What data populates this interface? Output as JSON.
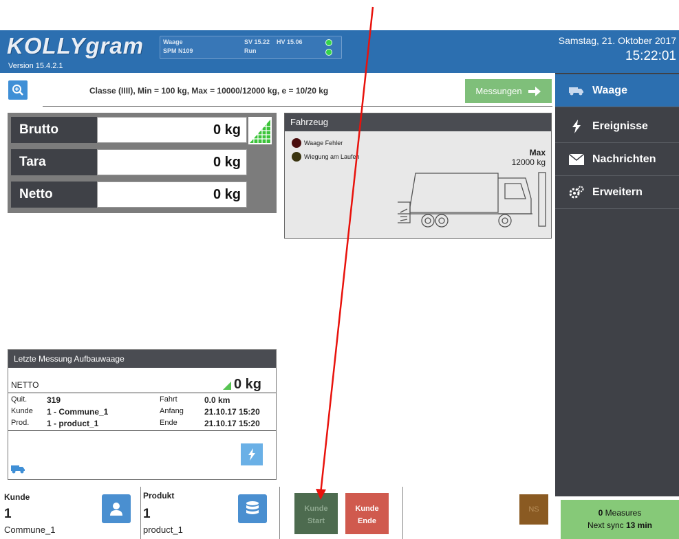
{
  "header": {
    "logo_text": "KOLLYgram",
    "version": "Version 15.4.2.1",
    "status": {
      "label_1": "Waage",
      "label_2": "SPM N109",
      "sv": "SV 15.22",
      "hv": "HV 15.06",
      "run": "Run"
    },
    "date": "Samstag, 21. Oktober 2017",
    "time": "15:22:01"
  },
  "info_bar": {
    "class_text": "Classe (IIII), Min = 100 kg, Max = 10000/12000 kg, e = 10/20 kg",
    "measure_button": "Messungen"
  },
  "sidebar": {
    "items": [
      {
        "label": "Waage",
        "icon": "truck-icon"
      },
      {
        "label": "Ereignisse",
        "icon": "bolt-icon"
      },
      {
        "label": "Nachrichten",
        "icon": "envelope-icon"
      },
      {
        "label": "Erweitern",
        "icon": "gears-icon"
      }
    ]
  },
  "weights": [
    {
      "label": "Brutto",
      "value": "0 kg"
    },
    {
      "label": "Tara",
      "value": "0 kg"
    },
    {
      "label": "Netto",
      "value": "0 kg"
    }
  ],
  "vehicle": {
    "title": "Fahrzeug",
    "legend": [
      {
        "label": "Waage Fehler",
        "color": "#4a0d0d"
      },
      {
        "label": "Wiegung am Laufen",
        "color": "#3a3410"
      }
    ],
    "max_label": "Max",
    "max_value": "12000 kg"
  },
  "last_measure": {
    "title": "Letzte Messung Aufbauwaage",
    "netto_label": "NETTO",
    "netto_value": "0 kg",
    "quit_label": "Quit.",
    "quit_value": "319",
    "kunde_label": "Kunde",
    "kunde_value": "1 - Commune_1",
    "prod_label": "Prod.",
    "prod_value": "1 - product_1",
    "fahrt_label": "Fahrt",
    "fahrt_value": "0.0 km",
    "anfang_label": "Anfang",
    "anfang_value": "21.10.17 15:20",
    "ende_label": "Ende",
    "ende_value": "21.10.17 15:20"
  },
  "bottom": {
    "kunde_label": "Kunde",
    "kunde_num": "1",
    "kunde_name": "Commune_1",
    "produkt_label": "Produkt",
    "produkt_num": "1",
    "produkt_name": "product_1",
    "start_line1": "Kunde",
    "start_line2": "Start",
    "end_line1": "Kunde",
    "end_line2": "Ende",
    "ns_label": "NS",
    "measures_count": "0",
    "measures_label": "Measures",
    "sync_prefix": "Next sync",
    "sync_value": "13 min"
  },
  "colors": {
    "header_blue": "#2c6fb0",
    "sidebar_dark": "#3f4147",
    "annotation_red": "#e8120c"
  }
}
